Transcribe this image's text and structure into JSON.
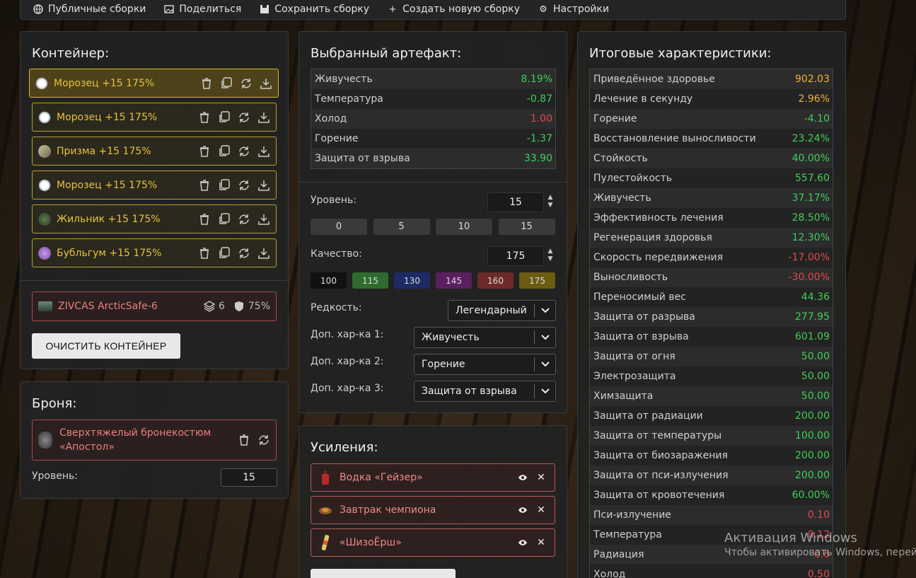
{
  "topbar": {
    "items": [
      {
        "label": "Публичные сборки",
        "icon": "globe-icon"
      },
      {
        "label": "Поделиться",
        "icon": "image-icon"
      },
      {
        "label": "Сохранить сборку",
        "icon": "save-icon"
      },
      {
        "label": "Создать новую сборку",
        "icon": "plus-icon"
      },
      {
        "label": "Настройки",
        "icon": "gear-icon"
      }
    ]
  },
  "container": {
    "title": "Контейнер:",
    "slots": [
      {
        "label": "Морозец +15 175%",
        "icon": "frost-artifact-icon",
        "active": true
      },
      {
        "label": "Морозец +15 175%",
        "icon": "frost-artifact-icon"
      },
      {
        "label": "Призма +15 175%",
        "icon": "prism-artifact-icon"
      },
      {
        "label": "Морозец +15 175%",
        "icon": "frost-artifact-icon"
      },
      {
        "label": "Жильник +15 175%",
        "icon": "vein-artifact-icon"
      },
      {
        "label": "Бубльгум +15 175%",
        "icon": "bubblegum-artifact-icon"
      }
    ],
    "item": {
      "label": "ZIVCAS ArcticSafe-6",
      "capacity": "6",
      "protection": "75%"
    },
    "clear_label": "ОЧИСТИТЬ КОНТЕЙНЕР"
  },
  "armor": {
    "title": "Броня:",
    "item_line1": "Сверхтяжелый бронекостюм",
    "item_line2": "«Апостол»",
    "level_label": "Уровень:",
    "level_value": "15"
  },
  "artifact": {
    "title": "Выбранный артефакт:",
    "stats": [
      {
        "name": "Живучесть",
        "value": "8.19%",
        "tone": "g"
      },
      {
        "name": "Температура",
        "value": "-0.87",
        "tone": "g"
      },
      {
        "name": "Холод",
        "value": "1.00",
        "tone": "r"
      },
      {
        "name": "Горение",
        "value": "-1.37",
        "tone": "g"
      },
      {
        "name": "Защита от взрыва",
        "value": "33.90",
        "tone": "g"
      }
    ],
    "level_label": "Уровень:",
    "level_value": "15",
    "level_presets": [
      "0",
      "5",
      "10",
      "15"
    ],
    "quality_label": "Качество:",
    "quality_value": "175",
    "quality_presets": [
      {
        "label": "100",
        "color": "#111111"
      },
      {
        "label": "115",
        "color": "#2f6b2f"
      },
      {
        "label": "130",
        "color": "#1e2a63"
      },
      {
        "label": "145",
        "color": "#5a1f5e"
      },
      {
        "label": "160",
        "color": "#6e2a2a"
      },
      {
        "label": "175",
        "color": "#6b5c12"
      }
    ],
    "rarity_label": "Редкость:",
    "rarity_value": "Легендарный",
    "extra1_label": "Доп. хар-ка 1:",
    "extra1_value": "Живучесть",
    "extra2_label": "Доп. хар-ка 2:",
    "extra2_value": "Горение",
    "extra3_label": "Доп. хар-ка 3:",
    "extra3_value": "Защита от взрыва"
  },
  "boosts": {
    "title": "Усиления:",
    "items": [
      {
        "label": "Водка «Гейзер»",
        "icon": "vodka-bottle-icon"
      },
      {
        "label": "Завтрак чемпиона",
        "icon": "breakfast-icon"
      },
      {
        "label": "«ШизоЁрш»",
        "icon": "drink-can-icon"
      }
    ]
  },
  "totals": {
    "title": "Итоговые характеристики:",
    "stats": [
      {
        "name": "Приведённое здоровье",
        "value": "902.03",
        "tone": "o"
      },
      {
        "name": "Лечение в секунду",
        "value": "2.96%",
        "tone": "o"
      },
      {
        "name": "Горение",
        "value": "-4.10",
        "tone": "g"
      },
      {
        "name": "Восстановление выносливости",
        "value": "23.24%",
        "tone": "g"
      },
      {
        "name": "Стойкость",
        "value": "40.00%",
        "tone": "g"
      },
      {
        "name": "Пулестойкость",
        "value": "557.60",
        "tone": "g"
      },
      {
        "name": "Живучесть",
        "value": "37.17%",
        "tone": "g"
      },
      {
        "name": "Эффективность лечения",
        "value": "28.50%",
        "tone": "g"
      },
      {
        "name": "Регенерация здоровья",
        "value": "12.30%",
        "tone": "g"
      },
      {
        "name": "Скорость передвижения",
        "value": "-17.00%",
        "tone": "r"
      },
      {
        "name": "Выносливость",
        "value": "-30.00%",
        "tone": "r"
      },
      {
        "name": "Переносимый вес",
        "value": "44.36",
        "tone": "g"
      },
      {
        "name": "Защита от разрыва",
        "value": "277.95",
        "tone": "g"
      },
      {
        "name": "Защита от взрыва",
        "value": "601.09",
        "tone": "g"
      },
      {
        "name": "Защита от огня",
        "value": "50.00",
        "tone": "g"
      },
      {
        "name": "Электрозащита",
        "value": "50.00",
        "tone": "g"
      },
      {
        "name": "Химзащита",
        "value": "50.00",
        "tone": "g"
      },
      {
        "name": "Защита от радиации",
        "value": "200.00",
        "tone": "g"
      },
      {
        "name": "Защита от температуры",
        "value": "100.00",
        "tone": "g"
      },
      {
        "name": "Защита от биозаражения",
        "value": "200.00",
        "tone": "g"
      },
      {
        "name": "Защита от пси-излучения",
        "value": "200.00",
        "tone": "g"
      },
      {
        "name": "Защита от кровотечения",
        "value": "60.00%",
        "tone": "g"
      },
      {
        "name": "Пси-излучение",
        "value": "0.10",
        "tone": "r"
      },
      {
        "name": "Температура",
        "value": "0.12",
        "tone": "r"
      },
      {
        "name": "Радиация",
        "value": "0.6",
        "tone": "r"
      },
      {
        "name": "Холод",
        "value": "0.50",
        "tone": "r"
      }
    ]
  },
  "watermark": {
    "line1": "Активация Windows",
    "line2": "Чтобы активировать Windows, перейдите"
  }
}
